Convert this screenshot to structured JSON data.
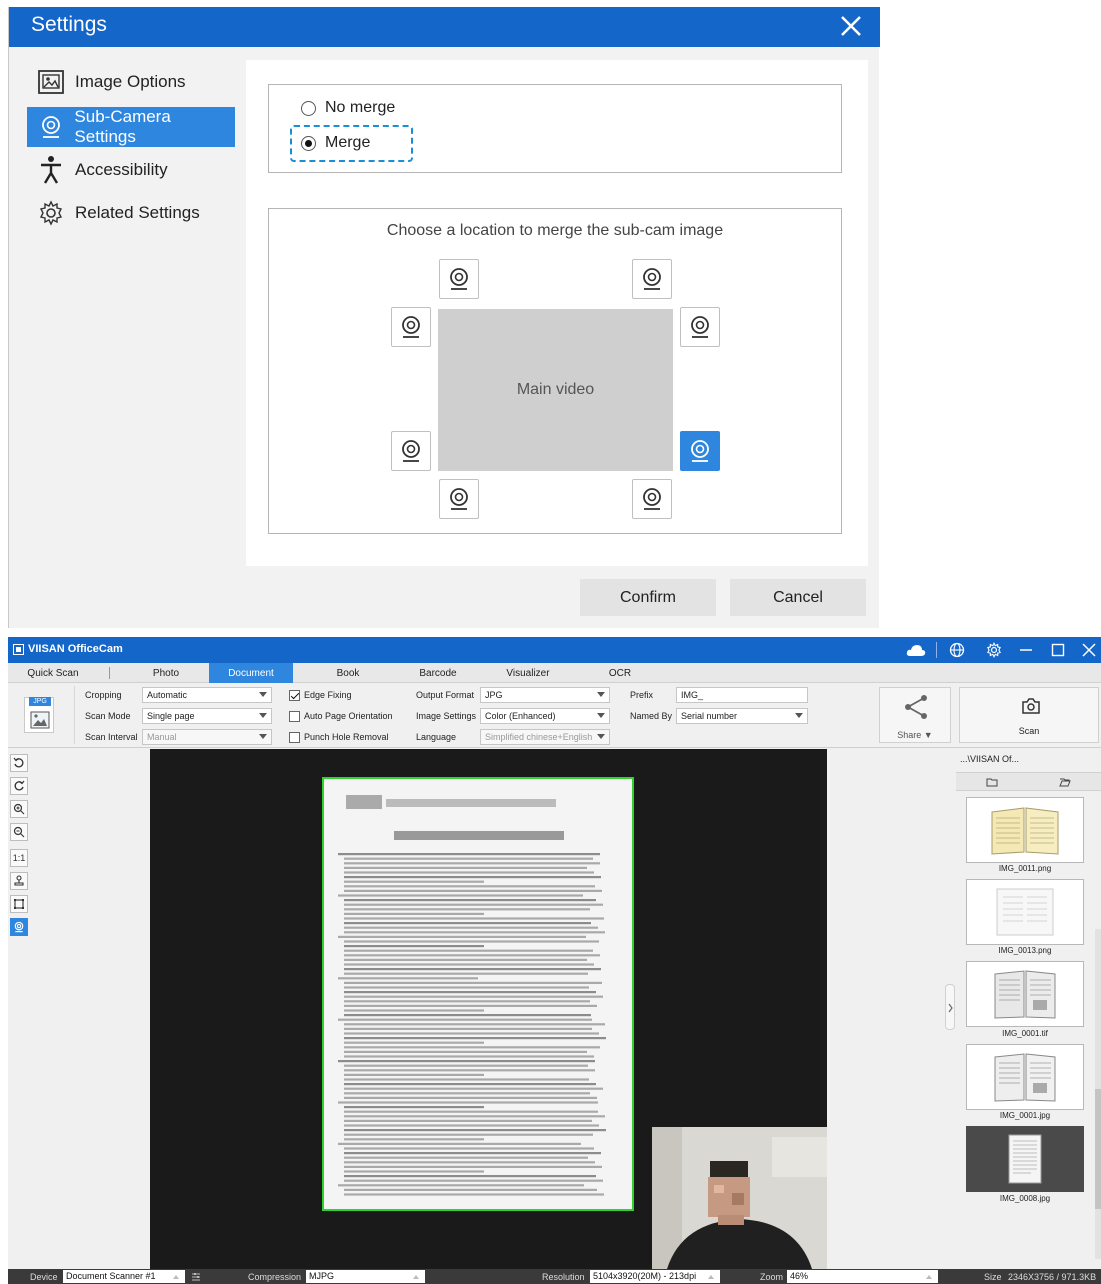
{
  "dialog": {
    "title": "Settings",
    "nav": {
      "image_options": "Image Options",
      "sub_camera": "Sub-Camera Settings",
      "accessibility": "Accessibility",
      "related": "Related Settings"
    },
    "no_merge": "No merge",
    "merge": "Merge",
    "location_prompt": "Choose a location to merge the sub-cam image",
    "main_video": "Main video",
    "confirm": "Confirm",
    "cancel": "Cancel"
  },
  "app": {
    "title": "VIISAN OfficeCam",
    "tabs": {
      "quick_scan": "Quick Scan",
      "photo": "Photo",
      "document": "Document",
      "book": "Book",
      "barcode": "Barcode",
      "visualizer": "Visualizer",
      "ocr": "OCR"
    },
    "badge": "JPG",
    "cropping_label": "Cropping",
    "cropping_value": "Automatic",
    "scan_mode_label": "Scan Mode",
    "scan_mode_value": "Single page",
    "scan_interval_label": "Scan Interval",
    "scan_interval_value": "Manual",
    "edge_fixing": "Edge Fixing",
    "auto_page_orientation": "Auto Page Orientation",
    "punch_hole_removal": "Punch Hole Removal",
    "output_format_label": "Output Format",
    "output_format_value": "JPG",
    "image_settings_label": "Image Settings",
    "image_settings_value": "Color (Enhanced)",
    "language_label": "Language",
    "language_value": "Simplified chinese+English",
    "prefix_label": "Prefix",
    "prefix_value": "IMG_",
    "named_by_label": "Named By",
    "named_by_value": "Serial number",
    "share": "Share ▼",
    "scan": "Scan",
    "tool_one_to_one": "1:1",
    "folder_path": "...\\VIISAN Of...",
    "thumbnails": [
      {
        "name": "IMG_0011.png"
      },
      {
        "name": "IMG_0013.png"
      },
      {
        "name": "IMG_0001.tif"
      },
      {
        "name": "IMG_0001.jpg"
      },
      {
        "name": "IMG_0008.jpg"
      }
    ],
    "status": {
      "device_label": "Device",
      "device_value": "Document Scanner #1",
      "compression_label": "Compression",
      "compression_value": "MJPG",
      "resolution_label": "Resolution",
      "resolution_value": "5104x3920(20M) - 213dpi",
      "zoom_label": "Zoom",
      "zoom_value": "46%",
      "size_label": "Size",
      "size_value": "2346X3756 / 971.3KB"
    }
  },
  "colors": {
    "title_blue": "#1466c9",
    "accent_blue": "#2e86de",
    "crop_green": "#2fd22f"
  }
}
